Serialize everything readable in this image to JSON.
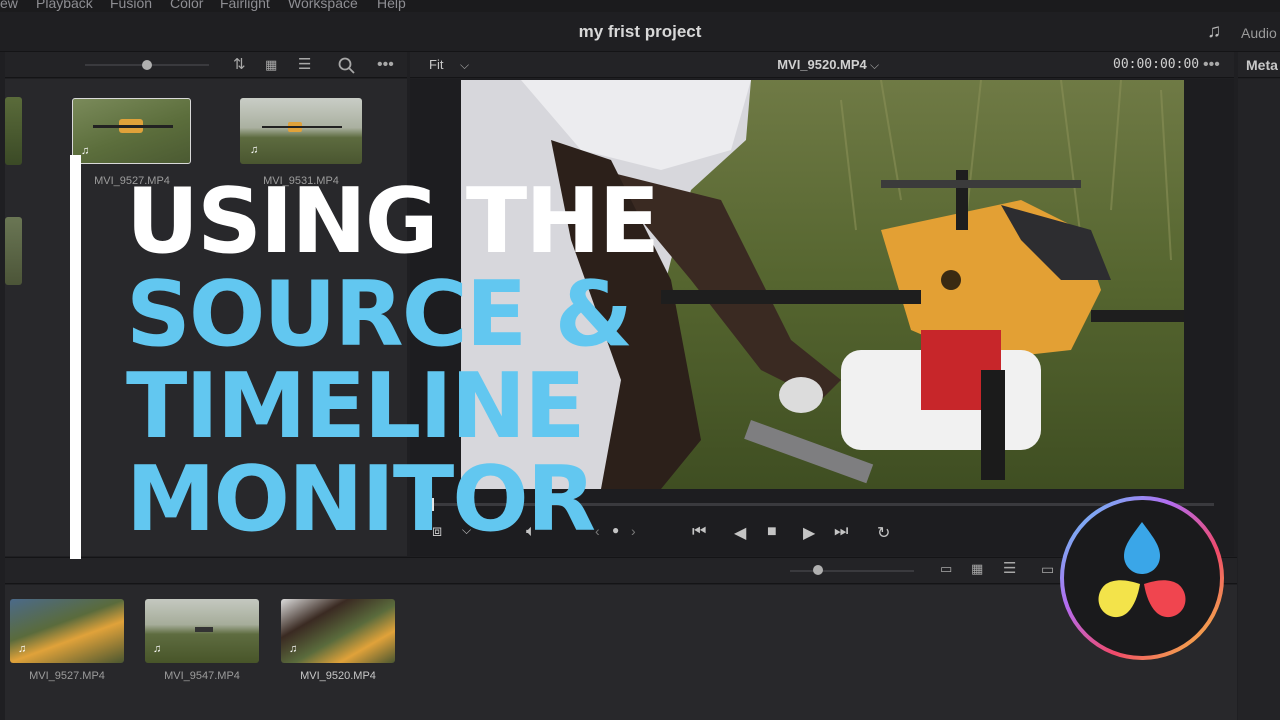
{
  "menu": [
    "ew",
    "Playback",
    "Fusion",
    "Color",
    "Fairlight",
    "Workspace",
    "Help"
  ],
  "project_title": "my frist project",
  "audio_tab_label": "Audio",
  "metadata_tab_label": "Meta",
  "viewer": {
    "zoom": "Fit",
    "clip_name": "MVI_9520.MP4",
    "timecode": "00:00:00:00"
  },
  "media_pool": {
    "clips": [
      {
        "name": "MVI_9527.MP4"
      },
      {
        "name": "MVI_9531.MP4"
      }
    ]
  },
  "timeline_pool": {
    "clips": [
      {
        "name": "MVI_9527.MP4"
      },
      {
        "name": "MVI_9547.MP4"
      },
      {
        "name": "MVI_9520.MP4"
      }
    ]
  },
  "headline": {
    "line1": "USING THE",
    "line2": "SOURCE &",
    "line3": "TIMELINE",
    "line4": "MONITOR"
  },
  "colors": {
    "accent_blue": "#62c7f0",
    "panel_bg": "#28282b",
    "headline_white": "#ffffff"
  },
  "icons": [
    "music-note-icon",
    "sort-icon",
    "grid-view-icon",
    "list-view-icon",
    "search-icon",
    "more-options-icon",
    "chevron-down-icon",
    "volume-icon",
    "skip-back-icon",
    "play-reverse-icon",
    "stop-icon",
    "play-icon",
    "skip-forward-icon",
    "loop-icon",
    "resolve-logo"
  ]
}
